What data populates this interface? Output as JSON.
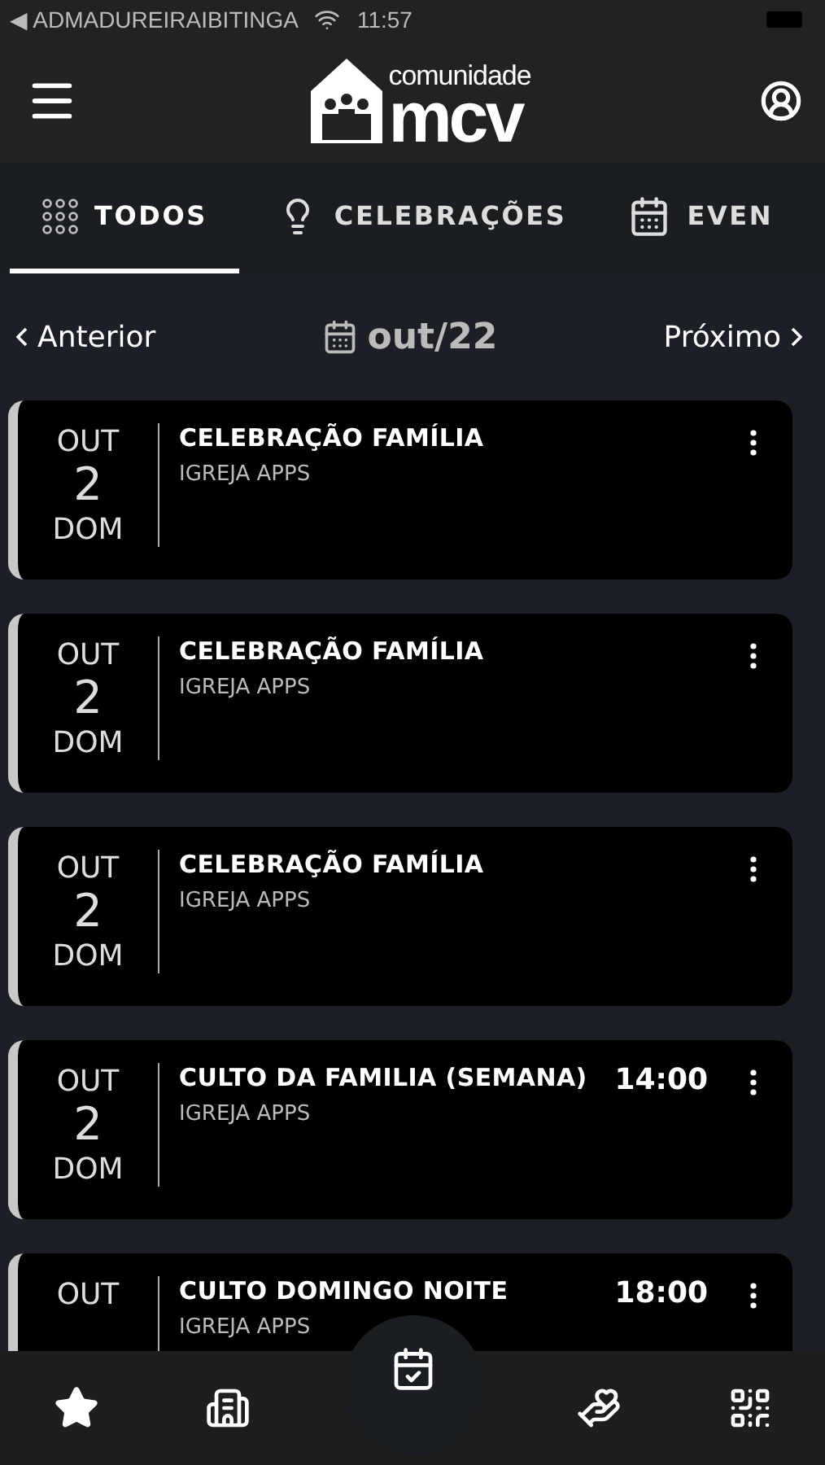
{
  "status_bar": {
    "back_app": "◀ ADMADUREIRAIBITINGA",
    "time": "11:57"
  },
  "header": {
    "logo": {
      "top": "comunidade",
      "main": "mcv"
    }
  },
  "tabs": [
    {
      "label": "TODOS",
      "kind": "grid",
      "selected": true
    },
    {
      "label": "CELEBRAÇÕES",
      "kind": "bulb",
      "selected": false
    },
    {
      "label": "EVEN",
      "kind": "calendar",
      "selected": false
    }
  ],
  "month_nav": {
    "previous": "Anterior",
    "current": "out/22",
    "next": "Próximo"
  },
  "events": [
    {
      "month": "OUT",
      "day": "2",
      "weekday": "DOM",
      "title": "CELEBRAÇÃO FAMÍLIA",
      "subtitle": "IGREJA APPS"
    },
    {
      "month": "OUT",
      "day": "2",
      "weekday": "DOM",
      "title": "CELEBRAÇÃO FAMÍLIA",
      "subtitle": "IGREJA APPS"
    },
    {
      "month": "OUT",
      "day": "2",
      "weekday": "DOM",
      "title": "CELEBRAÇÃO FAMÍLIA",
      "subtitle": "IGREJA APPS"
    },
    {
      "month": "OUT",
      "day": "2",
      "weekday": "DOM",
      "title": "CULTO DA FAMILIA (SEMANA)",
      "subtitle": "IGREJA APPS",
      "time": "14:00"
    },
    {
      "month": "OUT",
      "title": "CULTO DOMINGO NOITE",
      "subtitle": "IGREJA APPS",
      "time": "18:00"
    }
  ],
  "bottom_nav": [
    {
      "kind": "star",
      "selected": false
    },
    {
      "kind": "building",
      "selected": false
    },
    {
      "kind": "calendar",
      "selected": true
    },
    {
      "kind": "donate",
      "selected": false
    },
    {
      "kind": "qr",
      "selected": false
    }
  ]
}
